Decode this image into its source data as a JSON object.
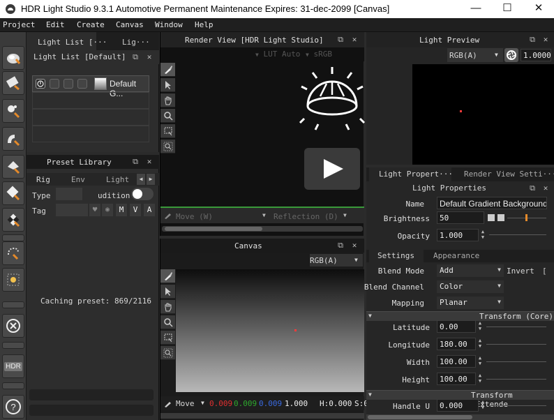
{
  "window": {
    "title": "HDR Light Studio 9.3.1   Automotive Permanent Maintenance Expires: 31-dec-2099 [Canvas]",
    "minimize": "—",
    "maximize": "☐",
    "close": "✕"
  },
  "menu": [
    "Project",
    "Edit",
    "Create",
    "Canvas",
    "Window",
    "Help"
  ],
  "light_list": {
    "tabs": [
      "Light List [···",
      "Lig···"
    ],
    "header": "Light List [Default]",
    "items": [
      {
        "label": "Default G..."
      }
    ]
  },
  "preset_library": {
    "header": "Preset Library",
    "tabs": [
      "Rig",
      "Env",
      "Light"
    ],
    "type_label": "Type",
    "type_toggle_label": "udition",
    "tag_label": "Tag",
    "tag_buttons": [
      "M",
      "V",
      "A"
    ],
    "status": "Caching preset: 869/2116"
  },
  "render_view": {
    "header": "Render View [HDR Light Studio]",
    "lut": "LUT Auto",
    "colorspace": "sRGB",
    "move_mode": "Move (W)",
    "reflection_mode": "Reflection (D)"
  },
  "canvas": {
    "header": "Canvas",
    "channel": "RGB(A)",
    "move_mode": "Move",
    "readout_r": "0.009",
    "readout_g": "0.009",
    "readout_b": "0.009",
    "readout_a": "1.000",
    "readout_h": "H:0.000",
    "readout_s": "S:0"
  },
  "light_preview": {
    "header": "Light Preview",
    "channel": "RGB(A)",
    "exposure": "1.0000"
  },
  "props": {
    "tabs": [
      "Light Propert···",
      "Render View Setti···"
    ],
    "header": "Light Properties",
    "name_label": "Name",
    "name_value": "Default Gradient Background",
    "brightness_label": "Brightness",
    "brightness_value": "50",
    "opacity_label": "Opacity",
    "opacity_value": "1.000",
    "subtabs": [
      "Settings",
      "Appearance"
    ],
    "blend_mode_label": "Blend Mode",
    "blend_mode_value": "Add",
    "invert_label": "Invert",
    "blend_channel_label": "Blend Channel",
    "blend_channel_value": "Color",
    "mapping_label": "Mapping",
    "mapping_value": "Planar",
    "transform_core": "Transform (Core)",
    "latitude_label": "Latitude",
    "latitude_value": "0.00",
    "longitude_label": "Longitude",
    "longitude_value": "180.00",
    "width_label": "Width",
    "width_value": "100.00",
    "height_label": "Height",
    "height_value": "100.00",
    "transform_extended": "Transform (Extende",
    "handle_u_label": "Handle U",
    "handle_u_value": "0.000"
  },
  "left_toolbar": {
    "icons": [
      "spot-light-icon",
      "area-light-icon",
      "sparkle-light-icon",
      "bent-light-icon",
      "light-shape-icon",
      "reflector-icon",
      "checker-light-icon",
      "lasso-light-icon",
      "sun-light-icon",
      "remove-light-icon",
      "hdr-icon",
      "help-icon"
    ],
    "hdr_label": "HDR"
  },
  "colors": {
    "accent_green": "#3a9a3a",
    "readout_red": "#e03030",
    "readout_green": "#2ea82e",
    "readout_blue": "#3a6ae0",
    "marker_red": "#ff3b3b"
  }
}
